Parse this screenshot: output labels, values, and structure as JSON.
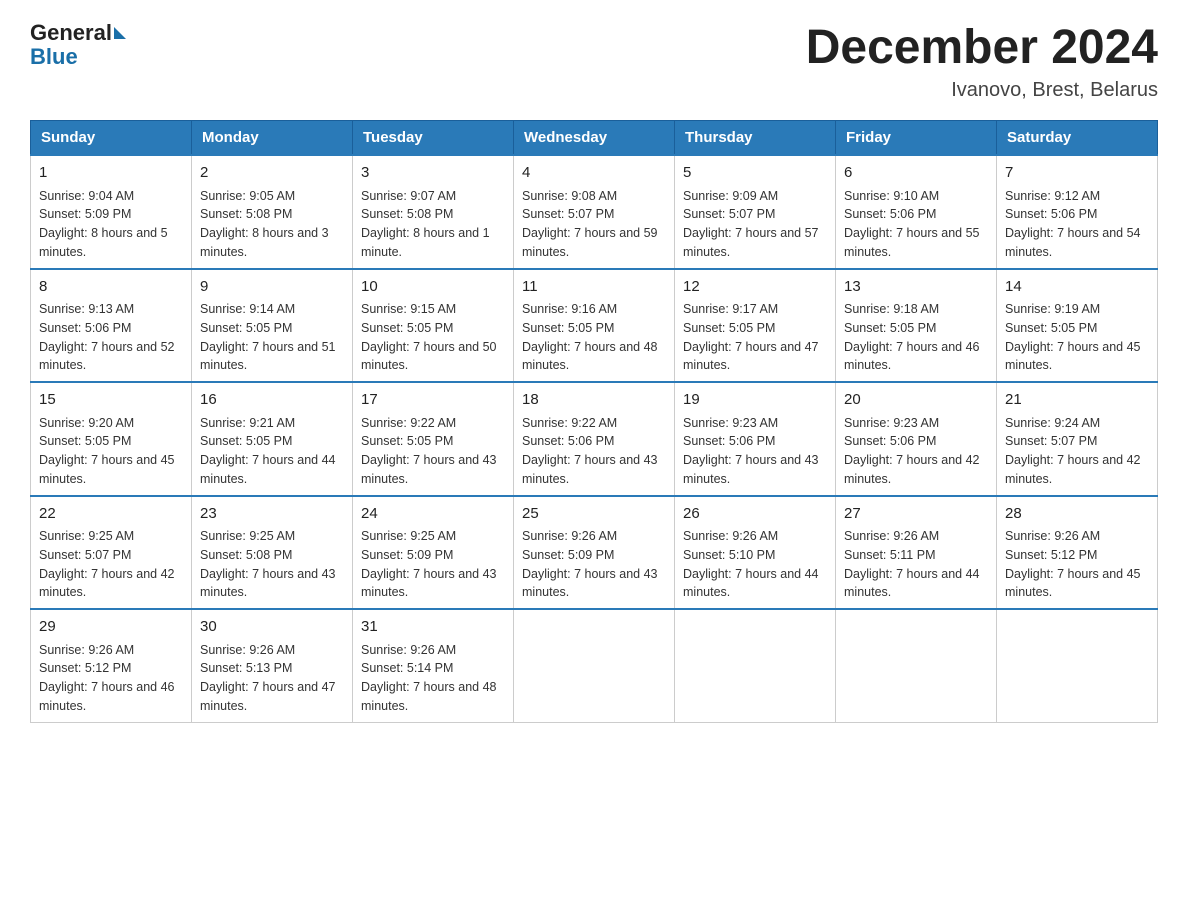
{
  "header": {
    "logo_general": "General",
    "logo_blue": "Blue",
    "month_title": "December 2024",
    "location": "Ivanovo, Brest, Belarus"
  },
  "days_of_week": [
    "Sunday",
    "Monday",
    "Tuesday",
    "Wednesday",
    "Thursday",
    "Friday",
    "Saturday"
  ],
  "weeks": [
    [
      {
        "day": 1,
        "sunrise": "9:04 AM",
        "sunset": "5:09 PM",
        "daylight": "8 hours and 5 minutes."
      },
      {
        "day": 2,
        "sunrise": "9:05 AM",
        "sunset": "5:08 PM",
        "daylight": "8 hours and 3 minutes."
      },
      {
        "day": 3,
        "sunrise": "9:07 AM",
        "sunset": "5:08 PM",
        "daylight": "8 hours and 1 minute."
      },
      {
        "day": 4,
        "sunrise": "9:08 AM",
        "sunset": "5:07 PM",
        "daylight": "7 hours and 59 minutes."
      },
      {
        "day": 5,
        "sunrise": "9:09 AM",
        "sunset": "5:07 PM",
        "daylight": "7 hours and 57 minutes."
      },
      {
        "day": 6,
        "sunrise": "9:10 AM",
        "sunset": "5:06 PM",
        "daylight": "7 hours and 55 minutes."
      },
      {
        "day": 7,
        "sunrise": "9:12 AM",
        "sunset": "5:06 PM",
        "daylight": "7 hours and 54 minutes."
      }
    ],
    [
      {
        "day": 8,
        "sunrise": "9:13 AM",
        "sunset": "5:06 PM",
        "daylight": "7 hours and 52 minutes."
      },
      {
        "day": 9,
        "sunrise": "9:14 AM",
        "sunset": "5:05 PM",
        "daylight": "7 hours and 51 minutes."
      },
      {
        "day": 10,
        "sunrise": "9:15 AM",
        "sunset": "5:05 PM",
        "daylight": "7 hours and 50 minutes."
      },
      {
        "day": 11,
        "sunrise": "9:16 AM",
        "sunset": "5:05 PM",
        "daylight": "7 hours and 48 minutes."
      },
      {
        "day": 12,
        "sunrise": "9:17 AM",
        "sunset": "5:05 PM",
        "daylight": "7 hours and 47 minutes."
      },
      {
        "day": 13,
        "sunrise": "9:18 AM",
        "sunset": "5:05 PM",
        "daylight": "7 hours and 46 minutes."
      },
      {
        "day": 14,
        "sunrise": "9:19 AM",
        "sunset": "5:05 PM",
        "daylight": "7 hours and 45 minutes."
      }
    ],
    [
      {
        "day": 15,
        "sunrise": "9:20 AM",
        "sunset": "5:05 PM",
        "daylight": "7 hours and 45 minutes."
      },
      {
        "day": 16,
        "sunrise": "9:21 AM",
        "sunset": "5:05 PM",
        "daylight": "7 hours and 44 minutes."
      },
      {
        "day": 17,
        "sunrise": "9:22 AM",
        "sunset": "5:05 PM",
        "daylight": "7 hours and 43 minutes."
      },
      {
        "day": 18,
        "sunrise": "9:22 AM",
        "sunset": "5:06 PM",
        "daylight": "7 hours and 43 minutes."
      },
      {
        "day": 19,
        "sunrise": "9:23 AM",
        "sunset": "5:06 PM",
        "daylight": "7 hours and 43 minutes."
      },
      {
        "day": 20,
        "sunrise": "9:23 AM",
        "sunset": "5:06 PM",
        "daylight": "7 hours and 42 minutes."
      },
      {
        "day": 21,
        "sunrise": "9:24 AM",
        "sunset": "5:07 PM",
        "daylight": "7 hours and 42 minutes."
      }
    ],
    [
      {
        "day": 22,
        "sunrise": "9:25 AM",
        "sunset": "5:07 PM",
        "daylight": "7 hours and 42 minutes."
      },
      {
        "day": 23,
        "sunrise": "9:25 AM",
        "sunset": "5:08 PM",
        "daylight": "7 hours and 43 minutes."
      },
      {
        "day": 24,
        "sunrise": "9:25 AM",
        "sunset": "5:09 PM",
        "daylight": "7 hours and 43 minutes."
      },
      {
        "day": 25,
        "sunrise": "9:26 AM",
        "sunset": "5:09 PM",
        "daylight": "7 hours and 43 minutes."
      },
      {
        "day": 26,
        "sunrise": "9:26 AM",
        "sunset": "5:10 PM",
        "daylight": "7 hours and 44 minutes."
      },
      {
        "day": 27,
        "sunrise": "9:26 AM",
        "sunset": "5:11 PM",
        "daylight": "7 hours and 44 minutes."
      },
      {
        "day": 28,
        "sunrise": "9:26 AM",
        "sunset": "5:12 PM",
        "daylight": "7 hours and 45 minutes."
      }
    ],
    [
      {
        "day": 29,
        "sunrise": "9:26 AM",
        "sunset": "5:12 PM",
        "daylight": "7 hours and 46 minutes."
      },
      {
        "day": 30,
        "sunrise": "9:26 AM",
        "sunset": "5:13 PM",
        "daylight": "7 hours and 47 minutes."
      },
      {
        "day": 31,
        "sunrise": "9:26 AM",
        "sunset": "5:14 PM",
        "daylight": "7 hours and 48 minutes."
      },
      null,
      null,
      null,
      null
    ]
  ]
}
